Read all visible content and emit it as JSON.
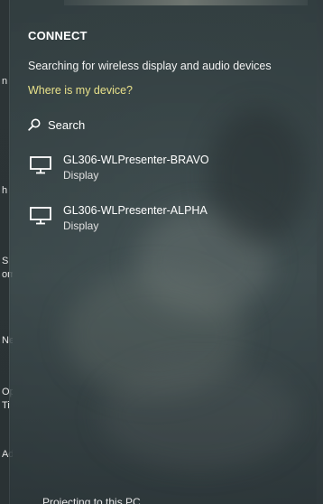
{
  "panel": {
    "title": "CONNECT",
    "status_text": "Searching for wireless display and audio devices",
    "help_link": "Where is my device?",
    "search_label": "Search",
    "devices": [
      {
        "name": "GL306-WLPresenter-BRAVO",
        "type": "Display",
        "icon": "monitor-icon"
      },
      {
        "name": "GL306-WLPresenter-ALPHA",
        "type": "Display",
        "icon": "monitor-icon"
      }
    ],
    "footer_text": "Projecting to this PC"
  },
  "background_fragments": [
    "n",
    "h",
    "S",
    "om",
    "Ne",
    "Op",
    "Ti",
    "Add"
  ],
  "colors": {
    "panel_bg": "#3e4c4e",
    "link": "#e8e18a",
    "text": "#ffffff"
  }
}
